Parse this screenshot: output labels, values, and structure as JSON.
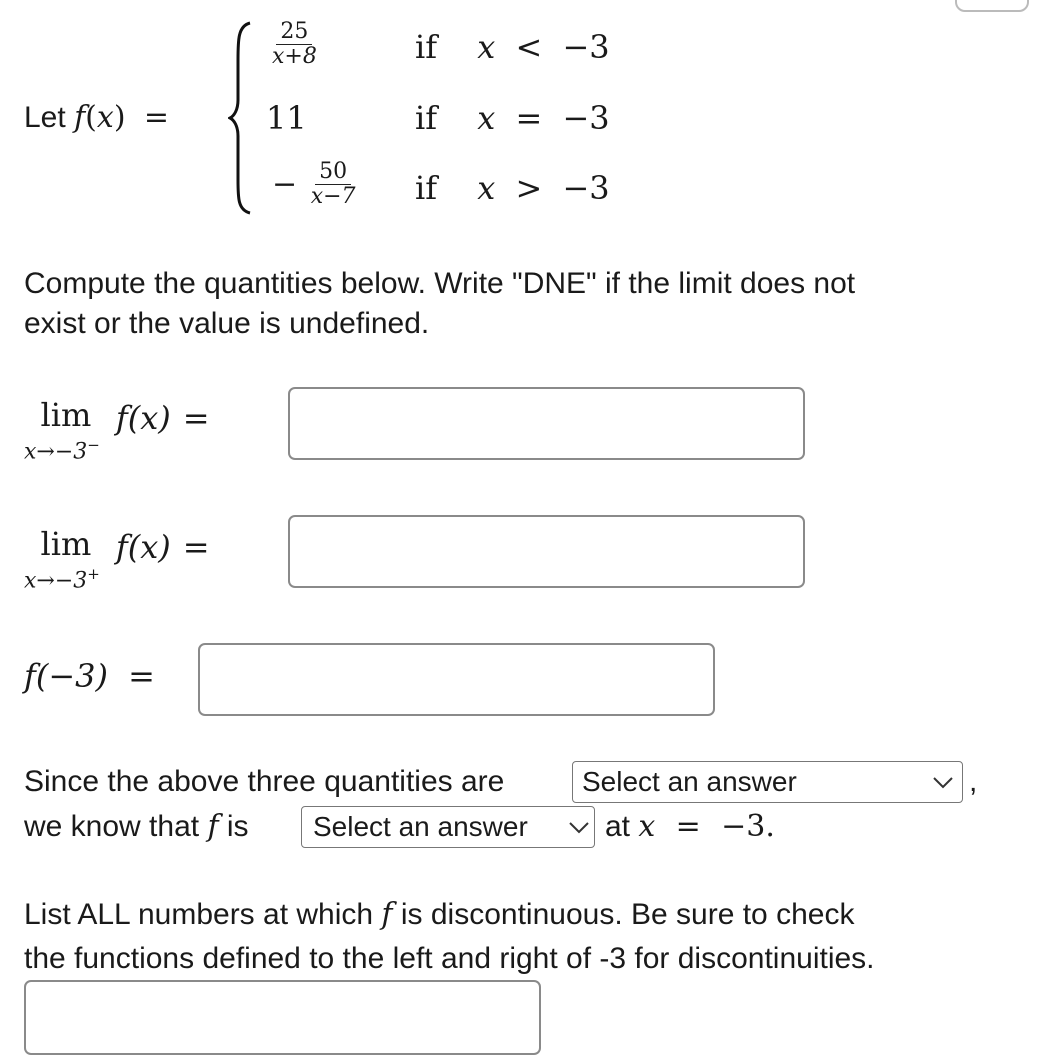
{
  "piecewise": {
    "lead_text": "Let",
    "fname": "f",
    "var": "x",
    "cases": [
      {
        "num": "25",
        "den": "x+8",
        "sign": "",
        "cond_word": "if",
        "cond_var": "x",
        "relation": "<",
        "bound": "−3"
      },
      {
        "value": "11",
        "cond_word": "if",
        "cond_var": "x",
        "relation": "=",
        "bound": "−3"
      },
      {
        "num": "50",
        "den": "x−7",
        "sign": "−",
        "cond_word": "if",
        "cond_var": "x",
        "relation": ">",
        "bound": "−3"
      }
    ]
  },
  "instructions": {
    "line1": "Compute the quantities below. Write \"DNE\" if the limit does not",
    "line2": "exist or the value is undefined."
  },
  "questions": {
    "left_limit": {
      "lim": "lim",
      "sub": "x→−3",
      "sup": "−",
      "expr": "f(x)",
      "eq": "=",
      "value": ""
    },
    "right_limit": {
      "lim": "lim",
      "sub": "x→−3",
      "sup": "+",
      "expr": "f(x)",
      "eq": "=",
      "value": ""
    },
    "value_at": {
      "expr": "f(−3)",
      "eq": "=",
      "value": ""
    }
  },
  "conclusion": {
    "part1": "Since the above three quantities are",
    "select1": "Select an answer",
    "comma": ",",
    "part2": "we know that",
    "f": "f",
    "part3": "is",
    "select2": "Select an answer",
    "part4": "at",
    "x": "x",
    "eq": "=",
    "point": "−3."
  },
  "discontinuities": {
    "line1_a": "List ALL numbers at which",
    "f": "f",
    "line1_b": "is discontinuous. Be sure to check",
    "line2": "the functions defined to the left and right of -3 for discontinuities.",
    "value": ""
  }
}
